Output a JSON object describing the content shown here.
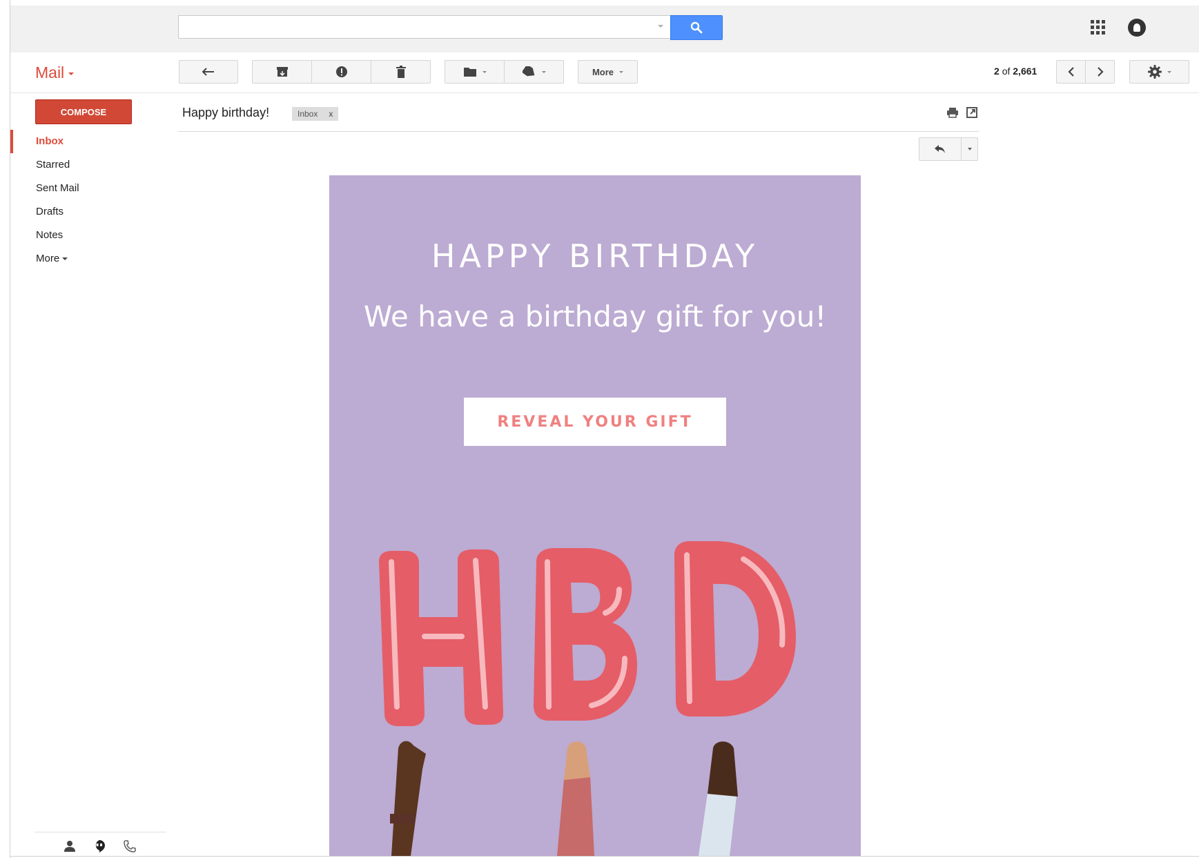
{
  "header": {
    "search": {
      "value": "",
      "placeholder": ""
    },
    "icons": [
      "search-icon",
      "apps-grid-icon",
      "account-icon"
    ]
  },
  "toolbar": {
    "app_title": "Mail",
    "more_label": "More",
    "page_current": "2",
    "page_of": "of",
    "page_total": "2,661",
    "icons": [
      "back-arrow-icon",
      "archive-icon",
      "report-spam-icon",
      "trash-icon",
      "folder-icon",
      "label-tag-icon",
      "chevron-left-icon",
      "chevron-right-icon",
      "gear-icon"
    ]
  },
  "sidebar": {
    "compose_label": "COMPOSE",
    "items": [
      {
        "label": "Inbox",
        "active": true
      },
      {
        "label": "Starred"
      },
      {
        "label": "Sent Mail"
      },
      {
        "label": "Drafts"
      },
      {
        "label": "Notes"
      },
      {
        "label": "More"
      }
    ],
    "footer_icons": [
      "person-icon",
      "hangouts-icon",
      "phone-icon"
    ]
  },
  "message": {
    "subject": "Happy birthday!",
    "label_chip": "Inbox",
    "label_remove": "x",
    "icons": [
      "print-icon",
      "new-window-icon",
      "reply-icon"
    ]
  },
  "email": {
    "heading": "HAPPY BIRTHDAY",
    "subheading": "We have a birthday gift for you!",
    "cta_label": "REVEAL YOUR GIFT",
    "balloon_letters": "HBD",
    "colors": {
      "background": "#bcabd2",
      "cta_text": "#f08080",
      "balloon": "#e8636b"
    }
  },
  "colors": {
    "brand_red": "#dd4b39",
    "compose_red": "#d14836",
    "search_blue": "#4d90fe"
  }
}
